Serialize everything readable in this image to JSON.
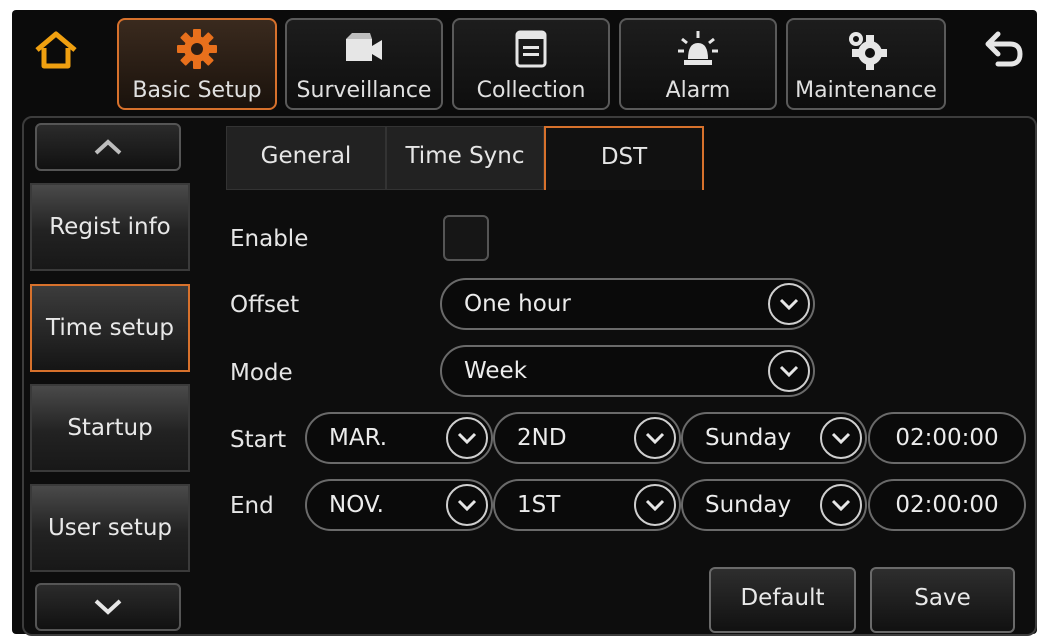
{
  "colors": {
    "accent": "#d7712c",
    "home_icon": "#f0a010",
    "background": "#0b0b0b"
  },
  "nav": {
    "home_icon": "home-icon",
    "back_icon": "back-arrow-icon",
    "tabs": [
      {
        "label": "Basic Setup",
        "icon": "gear-icon",
        "active": true
      },
      {
        "label": "Surveillance",
        "icon": "camera-icon",
        "active": false
      },
      {
        "label": "Collection",
        "icon": "document-icon",
        "active": false
      },
      {
        "label": "Alarm",
        "icon": "alarm-light-icon",
        "active": false
      },
      {
        "label": "Maintenance",
        "icon": "gears-icon",
        "active": false
      }
    ]
  },
  "sidebar": {
    "up_icon": "chevron-up-icon",
    "down_icon": "chevron-down-icon",
    "items": [
      {
        "label": "Regist info",
        "active": false
      },
      {
        "label": "Time setup",
        "active": true
      },
      {
        "label": "Startup",
        "active": false
      },
      {
        "label": "User setup",
        "active": false
      }
    ]
  },
  "subtabs": [
    {
      "label": "General",
      "active": false
    },
    {
      "label": "Time Sync",
      "active": false
    },
    {
      "label": "DST",
      "active": true
    }
  ],
  "form": {
    "enable": {
      "label": "Enable",
      "checked": false
    },
    "offset": {
      "label": "Offset",
      "value": "One hour"
    },
    "mode": {
      "label": "Mode",
      "value": "Week"
    },
    "start": {
      "label": "Start",
      "month": "MAR.",
      "week": "2ND",
      "day": "Sunday",
      "time": "02:00:00"
    },
    "end": {
      "label": "End",
      "month": "NOV.",
      "week": "1ST",
      "day": "Sunday",
      "time": "02:00:00"
    }
  },
  "buttons": {
    "default_label": "Default",
    "save_label": "Save"
  }
}
